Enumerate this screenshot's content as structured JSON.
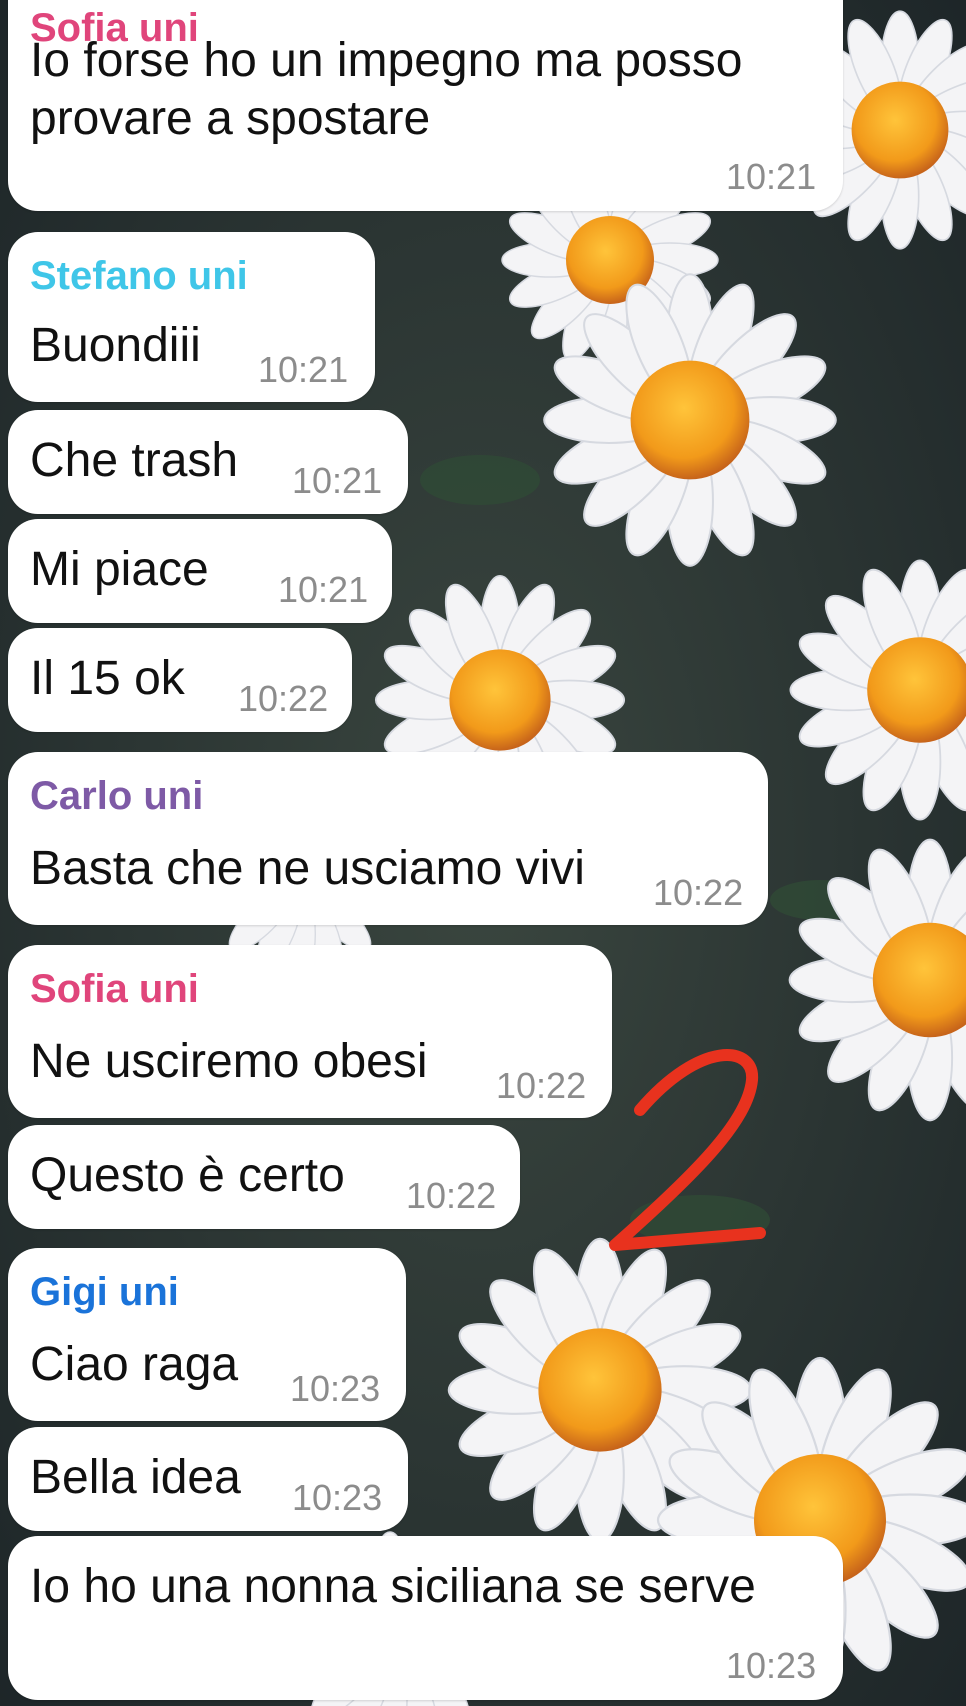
{
  "colors": {
    "bubble": "#ffffff",
    "time": "#8c8c8c",
    "annotation": "#e8321e"
  },
  "annotation": {
    "text": "2",
    "style": "handwritten red marker"
  },
  "messages": [
    {
      "sender": "Sofia uni",
      "sender_color": "#e0457b",
      "lines": [
        "Io forse ho un impegno ma posso",
        "provare a spostare"
      ],
      "time": "10:21"
    },
    {
      "sender": "Stefano uni",
      "sender_color": "#3fc6e8",
      "lines": [
        "Buondiii"
      ],
      "time": "10:21"
    },
    {
      "sender": "",
      "lines": [
        "Che trash"
      ],
      "time": "10:21"
    },
    {
      "sender": "",
      "lines": [
        "Mi piace"
      ],
      "time": "10:21"
    },
    {
      "sender": "",
      "lines": [
        "Il 15 ok"
      ],
      "time": "10:22"
    },
    {
      "sender": "Carlo uni",
      "sender_color": "#7e5aa6",
      "lines": [
        "Basta che ne usciamo vivi"
      ],
      "time": "10:22"
    },
    {
      "sender": "Sofia uni",
      "sender_color": "#e0457b",
      "lines": [
        "Ne usciremo obesi"
      ],
      "time": "10:22"
    },
    {
      "sender": "",
      "lines": [
        "Questo è certo"
      ],
      "time": "10:22"
    },
    {
      "sender": "Gigi uni",
      "sender_color": "#1a73d9",
      "lines": [
        "Ciao raga"
      ],
      "time": "10:23"
    },
    {
      "sender": "",
      "lines": [
        "Bella idea"
      ],
      "time": "10:23"
    },
    {
      "sender": "",
      "lines": [
        "Io ho una nonna siciliana se serve"
      ],
      "time": "10:23"
    }
  ]
}
